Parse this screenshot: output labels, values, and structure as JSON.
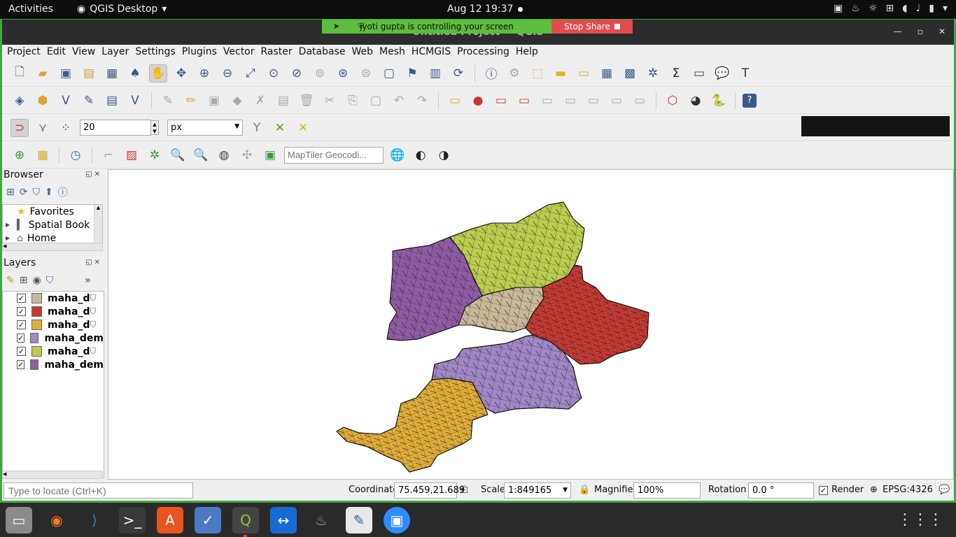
{
  "topbar": {
    "activities": "Activities",
    "app": "QGIS Desktop",
    "clock": "Aug 12  19:37"
  },
  "share": {
    "message": "jyoti gupta is controlling your screen",
    "stop": "Stop Share"
  },
  "window": {
    "title": "Untitled Project — QGIS"
  },
  "menu": [
    "Project",
    "Edit",
    "View",
    "Layer",
    "Settings",
    "Plugins",
    "Vector",
    "Raster",
    "Database",
    "Web",
    "Mesh",
    "HCMGIS",
    "Processing",
    "Help"
  ],
  "snapping": {
    "tolerance": "20",
    "units": "px"
  },
  "geocoder": {
    "placeholder": "MapTiler Geocodi..."
  },
  "browser": {
    "title": "Browser",
    "items": [
      {
        "label": "Favorites",
        "icon": "star-icon"
      },
      {
        "label": "Spatial Book",
        "icon": "bookmark-icon"
      },
      {
        "label": "Home",
        "icon": "home-icon"
      }
    ]
  },
  "layers": {
    "title": "Layers",
    "items": [
      {
        "label": "maha_d",
        "color": "#c8b89a",
        "filtered": true
      },
      {
        "label": "maha_d",
        "color": "#c43a33",
        "filtered": true
      },
      {
        "label": "maha_d",
        "color": "#e0ae3a",
        "filtered": true
      },
      {
        "label": "maha_dem",
        "color": "#9f86c4",
        "filtered": false
      },
      {
        "label": "maha_d",
        "color": "#bccc4e",
        "filtered": true
      },
      {
        "label": "maha_dem",
        "color": "#8e5ca3",
        "filtered": false
      }
    ]
  },
  "status": {
    "locate_placeholder": "Type to locate (Ctrl+K)",
    "coordinate_label": "Coordinate",
    "coordinate": "75.459,21.689",
    "scale_label": "Scale",
    "scale": "1:849165",
    "magnifier_label": "Magnifier",
    "magnifier": "100%",
    "rotation_label": "Rotation",
    "rotation": "0.0 °",
    "render_label": "Render",
    "crs": "EPSG:4326"
  },
  "map_colors": {
    "west": "#8e5ca3",
    "north": "#bccc4e",
    "central": "#c8b89a",
    "east": "#c43a33",
    "south_purple": "#9f86c4",
    "south_yellow": "#e0ae3a"
  }
}
